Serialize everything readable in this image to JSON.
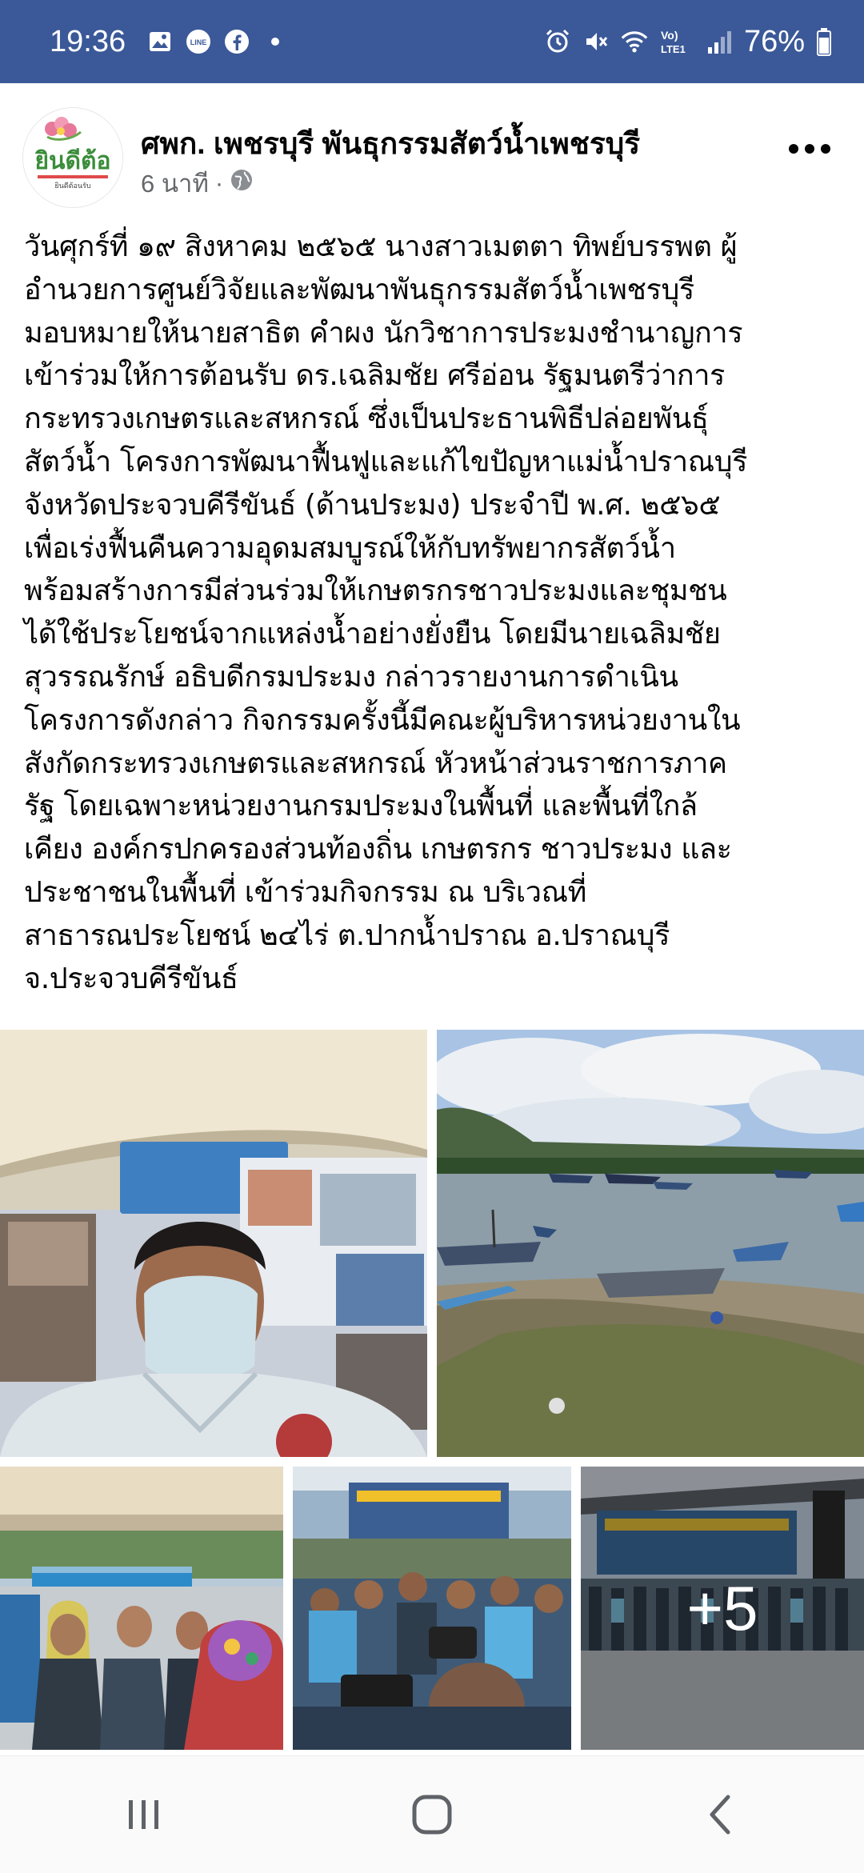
{
  "status_bar": {
    "time": "19:36",
    "left_icons": [
      "gallery-icon",
      "line-app-icon",
      "facebook-icon",
      "dot-icon"
    ],
    "right_icons": [
      "alarm-icon",
      "mute-icon",
      "wifi-icon",
      "volte-icon",
      "signal-icon"
    ],
    "volte_label": "Vo) LTE1",
    "battery": "76%",
    "background": "#3b5998"
  },
  "post": {
    "page_name": "ศพก. เพชรบุรี พันธุกรรมสัตว์น้ำเพชรบุรี",
    "time_ago": "6 นาที",
    "separator": "·",
    "audience_icon": "globe-icon",
    "logo_text": "ยินดีต้อ",
    "logo_subtext": "ยินดีต้อนรับ",
    "text_lines": [
      "วันศุกร์ที่ ๑๙ สิงหาคม ๒๕๖๕ นางสาวเมตตา ทิพย์บรรพต ผู้",
      "อำนวยการศูนย์วิจัยและพัฒนาพันธุกรรมสัตว์น้ำเพชรบุรี",
      "มอบหมายให้นายสาธิต คำผง นักวิชาการประมงชำนาญการ",
      "เข้าร่วมให้การต้อนรับ ดร.เฉลิมชัย ศรีอ่อน รัฐมนตรีว่าการ",
      "กระทรวงเกษตรและสหกรณ์ ซึ่งเป็นประธานพิธีปล่อยพันธุ์",
      "สัตว์น้ำ โครงการพัฒนาฟื้นฟูและแก้ไขปัญหาแม่น้ำปราณบุรี",
      "จังหวัดประจวบคีรีขันธ์ (ด้านประมง) ประจำปี พ.ศ. ๒๕๖๕",
      "เพื่อเร่งฟื้นคืนความอุดมสมบูรณ์ให้กับทรัพยากรสัตว์น้ำ",
      "พร้อมสร้างการมีส่วนร่วมให้เกษตรกรชาวประมงและชุมชน",
      "ได้ใช้ประโยชน์จากแหล่งน้ำอย่างยั่งยืน โดยมีนายเฉลิมชัย",
      "สุวรรณรักษ์ อธิบดีกรมประมง กล่าวรายงานการดำเนิน",
      "โครงการดังกล่าว กิจกรรมครั้งนี้มีคณะผู้บริหารหน่วยงานใน",
      "สังกัดกระทรวงเกษตรและสหกรณ์ หัวหน้าส่วนราชการภาค",
      "รัฐ โดยเฉพาะหน่วยงานกรมประมงในพื้นที่ และพื้นที่ใกล้",
      "เคียง องค์กรปกครองส่วนท้องถิ่น เกษตรกร ชาวประมง และ",
      "ประชาชนในพื้นที่ เข้าร่วมกิจกรรม ณ บริเวณที่",
      "สาธารณประโยชน์ ๒๔ไร่ ต.ปากน้ำปราณ อ.ปราณบุรี",
      "จ.ประจวบคีรีขันธ์"
    ],
    "photos": {
      "more_count": "+5"
    }
  },
  "nav_bar": {
    "buttons": [
      "recent-apps-icon",
      "home-icon",
      "back-icon"
    ]
  }
}
